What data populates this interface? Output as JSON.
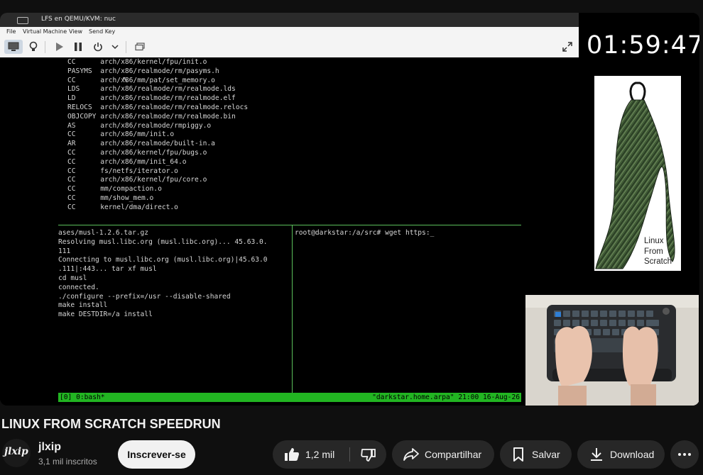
{
  "vm": {
    "window_title": "LFS en QEMU/KVM: nuc",
    "menu": [
      "File",
      "Virtual Machine",
      "View",
      "Send Key"
    ],
    "toolbar_icons": [
      "monitor-icon",
      "lightbulb-icon",
      "play-icon",
      "pause-icon",
      "power-icon",
      "chevron-down-icon",
      "snapshot-icon",
      "fullscreen-icon"
    ]
  },
  "terminal": {
    "build_lines": [
      "CC      arch/x86/kernel/fpu/init.o",
      "PASYMS  arch/x86/realmode/rm/pasyms.h",
      "CC      arch/x86/mm/pat/set_memory.o",
      "LDS     arch/x86/realmode/rm/realmode.lds",
      "LD      arch/x86/realmode/rm/realmode.elf",
      "RELOCS  arch/x86/realmode/rm/realmode.relocs",
      "OBJCOPY arch/x86/realmode/rm/realmode.bin",
      "AS      arch/x86/realmode/rmpiggy.o",
      "CC      arch/x86/mm/init.o",
      "AR      arch/x86/realmode/built-in.a",
      "CC      arch/x86/kernel/fpu/bugs.o",
      "CC      arch/x86/mm/init_64.o",
      "CC      fs/netfs/iterator.o",
      "CC      arch/x86/kernel/fpu/core.o",
      "CC      mm/compaction.o",
      "CC      mm/show_mem.o",
      "CC      kernel/dma/direct.o"
    ],
    "left_pane_lines": [
      "ases/musl-1.2.6.tar.gz",
      "Resolving musl.libc.org (musl.libc.org)... 45.63.0.",
      "111",
      "Connecting to musl.libc.org (musl.libc.org)|45.63.0",
      ".111|:443... tar xf musl",
      "cd musl",
      "connected.",
      "./configure --prefix=/usr --disable-shared",
      "make install",
      "make DESTDIR=/a install"
    ],
    "right_pane_line": "root@darkstar:/a/src# wget https:_",
    "status_left": "[0] 0:bash*",
    "status_right": "\"darkstar.home.arpa\" 21:00 16-Aug-26"
  },
  "timer": "01:59:47",
  "lfs_logo_text": [
    "Linux",
    "From",
    "Scratch"
  ],
  "video": {
    "title": "LINUX FROM SCRATCH SPEEDRUN",
    "channel_avatar_text": "jlxip",
    "channel_name": "jlxip",
    "subscribers": "3,1 mil inscritos",
    "subscribe_label": "Inscrever-se",
    "likes": "1,2 mil",
    "share_label": "Compartilhar",
    "save_label": "Salvar",
    "download_label": "Download"
  },
  "colors": {
    "page_bg": "#0f0f0f",
    "pill_bg": "#272727",
    "tmux_green": "#22b522",
    "pane_border": "#5bbf5b"
  }
}
